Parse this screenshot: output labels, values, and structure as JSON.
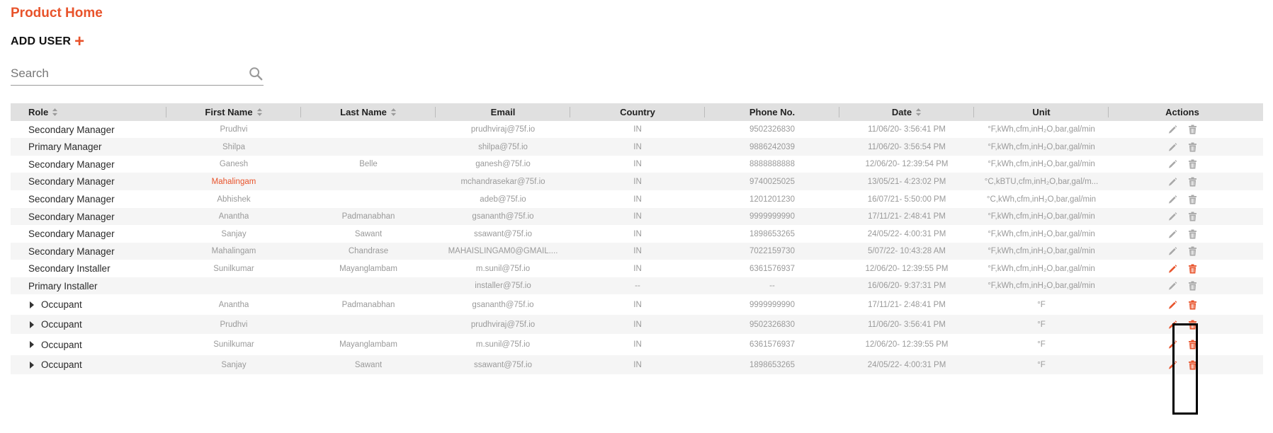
{
  "header": {
    "title": "Product Home",
    "add_user_label": "ADD USER",
    "add_user_plus": "+"
  },
  "search": {
    "placeholder": "Search",
    "value": ""
  },
  "colors": {
    "accent": "#e8532b",
    "header_bg": "#e0e0e0",
    "muted_text": "#9a9a9a",
    "disabled_icon": "#a8a8a8"
  },
  "table": {
    "columns": [
      {
        "key": "role",
        "label": "Role",
        "sortable": true
      },
      {
        "key": "first",
        "label": "First Name",
        "sortable": true
      },
      {
        "key": "last",
        "label": "Last Name",
        "sortable": true
      },
      {
        "key": "email",
        "label": "Email",
        "sortable": false
      },
      {
        "key": "country",
        "label": "Country",
        "sortable": false
      },
      {
        "key": "phone",
        "label": "Phone No.",
        "sortable": false
      },
      {
        "key": "date",
        "label": "Date",
        "sortable": true
      },
      {
        "key": "unit",
        "label": "Unit",
        "sortable": false
      },
      {
        "key": "actions",
        "label": "Actions",
        "sortable": false
      }
    ],
    "rows": [
      {
        "role": "Secondary Manager",
        "first": "Prudhvi",
        "last": "",
        "email": "prudhviraj@75f.io",
        "country": "IN",
        "phone": "9502326830",
        "date": "11/06/20- 3:56:41 PM",
        "unit": "°F,kWh,cfm,inH₂O,bar,gal/min",
        "actions_enabled": false
      },
      {
        "role": "Primary Manager",
        "first": "Shilpa",
        "last": "",
        "email": "shilpa@75f.io",
        "country": "IN",
        "phone": "9886242039",
        "date": "11/06/20- 3:56:54 PM",
        "unit": "°F,kWh,cfm,inH₂O,bar,gal/min",
        "actions_enabled": false
      },
      {
        "role": "Secondary Manager",
        "first": "Ganesh",
        "last": "Belle",
        "email": "ganesh@75f.io",
        "country": "IN",
        "phone": "8888888888",
        "date": "12/06/20- 12:39:54 PM",
        "unit": "°F,kWh,cfm,inH₂O,bar,gal/min",
        "actions_enabled": false
      },
      {
        "role": "Secondary Manager",
        "first": "Mahalingam",
        "first_highlight": true,
        "last": "",
        "email": "mchandrasekar@75f.io",
        "country": "IN",
        "phone": "9740025025",
        "date": "13/05/21- 4:23:02 PM",
        "unit": "°C,kBTU,cfm,inH₂O,bar,gal/m...",
        "actions_enabled": false
      },
      {
        "role": "Secondary Manager",
        "first": "Abhishek",
        "last": "",
        "email": "adeb@75f.io",
        "country": "IN",
        "phone": "1201201230",
        "date": "16/07/21- 5:50:00 PM",
        "unit": "°C,kWh,cfm,inH₂O,bar,gal/min",
        "actions_enabled": false
      },
      {
        "role": "Secondary Manager",
        "first": "Anantha",
        "last": "Padmanabhan",
        "email": "gsananth@75f.io",
        "country": "IN",
        "phone": "9999999990",
        "date": "17/11/21- 2:48:41 PM",
        "unit": "°F,kWh,cfm,inH₂O,bar,gal/min",
        "actions_enabled": false
      },
      {
        "role": "Secondary Manager",
        "first": "Sanjay",
        "last": "Sawant",
        "email": "ssawant@75f.io",
        "country": "IN",
        "phone": "1898653265",
        "date": "24/05/22- 4:00:31 PM",
        "unit": "°F,kWh,cfm,inH₂O,bar,gal/min",
        "actions_enabled": false
      },
      {
        "role": "Secondary Manager",
        "first": "Mahalingam",
        "last": "Chandrase",
        "email": "MAHAISLINGAM0@GMAIL....",
        "country": "IN",
        "phone": "7022159730",
        "date": "5/07/22- 10:43:28 AM",
        "unit": "°F,kWh,cfm,inH₂O,bar,gal/min",
        "actions_enabled": false
      },
      {
        "role": "Secondary Installer",
        "first": "Sunilkumar",
        "last": "Mayanglambam",
        "email": "m.sunil@75f.io",
        "country": "IN",
        "phone": "6361576937",
        "date": "12/06/20- 12:39:55 PM",
        "unit": "°F,kWh,cfm,inH₂O,bar,gal/min",
        "actions_enabled": true
      },
      {
        "role": "Primary Installer",
        "first": "",
        "last": "",
        "email": "installer@75f.io",
        "country": "--",
        "phone": "--",
        "date": "16/06/20- 9:37:31 PM",
        "unit": "°F,kWh,cfm,inH₂O,bar,gal/min",
        "actions_enabled": false
      },
      {
        "role": "Occupant",
        "expandable": true,
        "first": "Anantha",
        "last": "Padmanabhan",
        "email": "gsananth@75f.io",
        "country": "IN",
        "phone": "9999999990",
        "date": "17/11/21- 2:48:41 PM",
        "unit": "°F",
        "actions_enabled": true
      },
      {
        "role": "Occupant",
        "expandable": true,
        "first": "Prudhvi",
        "last": "",
        "email": "prudhviraj@75f.io",
        "country": "IN",
        "phone": "9502326830",
        "date": "11/06/20- 3:56:41 PM",
        "unit": "°F",
        "actions_enabled": true
      },
      {
        "role": "Occupant",
        "expandable": true,
        "first": "Sunilkumar",
        "last": "Mayanglambam",
        "email": "m.sunil@75f.io",
        "country": "IN",
        "phone": "6361576937",
        "date": "12/06/20- 12:39:55 PM",
        "unit": "°F",
        "actions_enabled": true
      },
      {
        "role": "Occupant",
        "expandable": true,
        "first": "Sanjay",
        "last": "Sawant",
        "email": "ssawant@75f.io",
        "country": "IN",
        "phone": "1898653265",
        "date": "24/05/22- 4:00:31 PM",
        "unit": "°F",
        "actions_enabled": true
      }
    ]
  },
  "icons": {
    "search": "search-icon",
    "sort": "sort-icon",
    "edit": "pencil-icon",
    "delete": "trash-icon",
    "expand": "caret-right-icon"
  }
}
